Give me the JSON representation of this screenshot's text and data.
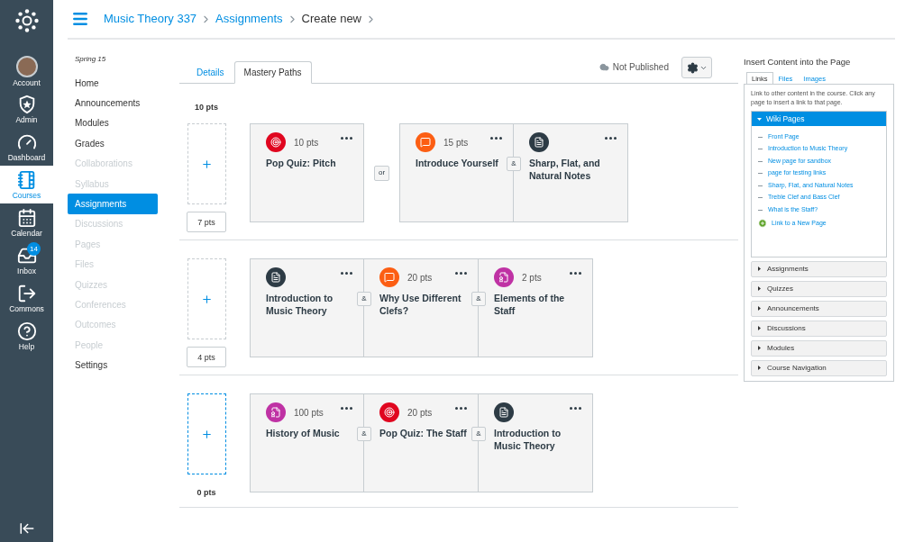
{
  "global_nav": {
    "items": [
      {
        "kind": "account",
        "label": "Account",
        "selected": false
      },
      {
        "kind": "admin",
        "label": "Admin",
        "selected": false
      },
      {
        "kind": "dashboard",
        "label": "Dashboard",
        "selected": false
      },
      {
        "kind": "courses",
        "label": "Courses",
        "selected": true
      },
      {
        "kind": "calendar",
        "label": "Calendar",
        "selected": false
      },
      {
        "kind": "inbox",
        "label": "Inbox",
        "selected": false,
        "badge": "14"
      },
      {
        "kind": "commons",
        "label": "Commons",
        "selected": false
      },
      {
        "kind": "help",
        "label": "Help",
        "selected": false
      }
    ]
  },
  "header": {
    "breadcrumb": [
      "Music Theory 337",
      "Assignments",
      "Create new"
    ]
  },
  "course_nav": {
    "term": "Spring 15",
    "items": [
      {
        "label": "Home",
        "selected": false,
        "disabled": false
      },
      {
        "label": "Announcements",
        "selected": false,
        "disabled": false
      },
      {
        "label": "Modules",
        "selected": false,
        "disabled": false
      },
      {
        "label": "Grades",
        "selected": false,
        "disabled": false
      },
      {
        "label": "Collaborations",
        "selected": false,
        "disabled": true
      },
      {
        "label": "Syllabus",
        "selected": false,
        "disabled": true
      },
      {
        "label": "Assignments",
        "selected": true,
        "disabled": false
      },
      {
        "label": "Discussions",
        "selected": false,
        "disabled": true
      },
      {
        "label": "Pages",
        "selected": false,
        "disabled": true
      },
      {
        "label": "Files",
        "selected": false,
        "disabled": true
      },
      {
        "label": "Quizzes",
        "selected": false,
        "disabled": true
      },
      {
        "label": "Conferences",
        "selected": false,
        "disabled": true
      },
      {
        "label": "Outcomes",
        "selected": false,
        "disabled": true
      },
      {
        "label": "People",
        "selected": false,
        "disabled": true
      },
      {
        "label": "Settings",
        "selected": false,
        "disabled": false
      }
    ]
  },
  "tabs": [
    {
      "label": "Details",
      "selected": false
    },
    {
      "label": "Mastery Paths",
      "selected": true
    }
  ],
  "status": "Not Published",
  "ranges": [
    {
      "upper": "10 pts",
      "lower": {
        "kind": "input",
        "text": "7 pts"
      },
      "drop_selected": false,
      "groups": [
        {
          "items": [
            {
              "kind": "quiz",
              "points": "10 pts",
              "title": "Pop Quiz: Pitch"
            }
          ]
        },
        {
          "joiner": "or",
          "items": [
            {
              "kind": "discussion",
              "points": "15 pts",
              "title": "Introduce Yourself"
            },
            {
              "joiner": "&",
              "kind": "page",
              "title": "Sharp, Flat, and Natural Notes"
            }
          ]
        }
      ]
    },
    {
      "lower": {
        "kind": "input",
        "text": "4 pts"
      },
      "drop_selected": false,
      "groups": [
        {
          "items": [
            {
              "kind": "page",
              "title": "Introduction to Music Theory"
            },
            {
              "joiner": "&",
              "kind": "discussion",
              "points": "20 pts",
              "title": "Why Use Different Clefs?"
            },
            {
              "joiner": "&",
              "kind": "assignment",
              "points": "2 pts",
              "title": "Elements of the Staff"
            }
          ]
        }
      ]
    },
    {
      "lower": {
        "kind": "text",
        "text": "0 pts"
      },
      "drop_selected": true,
      "groups": [
        {
          "items": [
            {
              "kind": "assignment",
              "points": "100 pts",
              "title": "History of Music"
            },
            {
              "joiner": "&",
              "kind": "quiz",
              "points": "20 pts",
              "title": "Pop Quiz: The Staff"
            },
            {
              "joiner": "&",
              "kind": "page",
              "title": "Introduction to Music Theory"
            }
          ]
        }
      ]
    }
  ],
  "insert_panel": {
    "title": "Insert Content into the Page",
    "tabs": [
      {
        "label": "Links",
        "selected": true
      },
      {
        "label": "Files",
        "selected": false
      },
      {
        "label": "Images",
        "selected": false
      }
    ],
    "description": "Link to other content in the course. Click any page to insert a link to that page.",
    "sections": [
      {
        "label": "Wiki Pages",
        "expanded": true,
        "links": [
          "Front Page",
          "Introduction to Music Theory",
          "New page for sandbox",
          "page for testing links",
          "Sharp, Flat, and Natural Notes",
          "Treble Clef and Bass Clef",
          "What is the Staff?"
        ],
        "new_link": "Link to a New Page"
      },
      {
        "label": "Assignments",
        "expanded": false
      },
      {
        "label": "Quizzes",
        "expanded": false
      },
      {
        "label": "Announcements",
        "expanded": false
      },
      {
        "label": "Discussions",
        "expanded": false
      },
      {
        "label": "Modules",
        "expanded": false
      },
      {
        "label": "Course Navigation",
        "expanded": false
      }
    ]
  }
}
